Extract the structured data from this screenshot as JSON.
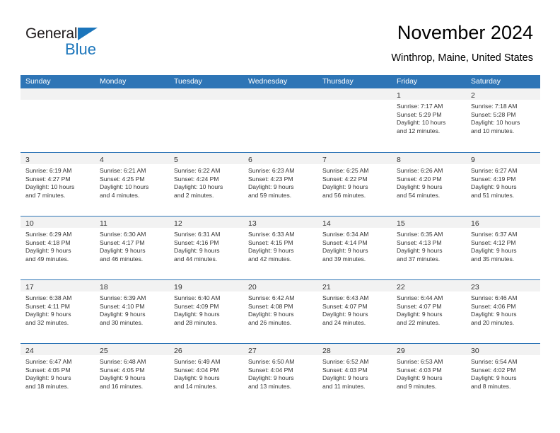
{
  "brand": {
    "name_dark": "General",
    "name_blue": "Blue",
    "accent_color": "#1b75bb"
  },
  "header": {
    "title": "November 2024",
    "subtitle": "Winthrop, Maine, United States"
  },
  "colors": {
    "header_blue": "#2e75b6",
    "daynum_band": "#f2f2f2",
    "text": "#333333"
  },
  "weekdays": [
    "Sunday",
    "Monday",
    "Tuesday",
    "Wednesday",
    "Thursday",
    "Friday",
    "Saturday"
  ],
  "weeks": [
    [
      {
        "day": ""
      },
      {
        "day": ""
      },
      {
        "day": ""
      },
      {
        "day": ""
      },
      {
        "day": ""
      },
      {
        "day": "1",
        "sunrise": "Sunrise: 7:17 AM",
        "sunset": "Sunset: 5:29 PM",
        "daylight1": "Daylight: 10 hours",
        "daylight2": "and 12 minutes."
      },
      {
        "day": "2",
        "sunrise": "Sunrise: 7:18 AM",
        "sunset": "Sunset: 5:28 PM",
        "daylight1": "Daylight: 10 hours",
        "daylight2": "and 10 minutes."
      }
    ],
    [
      {
        "day": "3",
        "sunrise": "Sunrise: 6:19 AM",
        "sunset": "Sunset: 4:27 PM",
        "daylight1": "Daylight: 10 hours",
        "daylight2": "and 7 minutes."
      },
      {
        "day": "4",
        "sunrise": "Sunrise: 6:21 AM",
        "sunset": "Sunset: 4:25 PM",
        "daylight1": "Daylight: 10 hours",
        "daylight2": "and 4 minutes."
      },
      {
        "day": "5",
        "sunrise": "Sunrise: 6:22 AM",
        "sunset": "Sunset: 4:24 PM",
        "daylight1": "Daylight: 10 hours",
        "daylight2": "and 2 minutes."
      },
      {
        "day": "6",
        "sunrise": "Sunrise: 6:23 AM",
        "sunset": "Sunset: 4:23 PM",
        "daylight1": "Daylight: 9 hours",
        "daylight2": "and 59 minutes."
      },
      {
        "day": "7",
        "sunrise": "Sunrise: 6:25 AM",
        "sunset": "Sunset: 4:22 PM",
        "daylight1": "Daylight: 9 hours",
        "daylight2": "and 56 minutes."
      },
      {
        "day": "8",
        "sunrise": "Sunrise: 6:26 AM",
        "sunset": "Sunset: 4:20 PM",
        "daylight1": "Daylight: 9 hours",
        "daylight2": "and 54 minutes."
      },
      {
        "day": "9",
        "sunrise": "Sunrise: 6:27 AM",
        "sunset": "Sunset: 4:19 PM",
        "daylight1": "Daylight: 9 hours",
        "daylight2": "and 51 minutes."
      }
    ],
    [
      {
        "day": "10",
        "sunrise": "Sunrise: 6:29 AM",
        "sunset": "Sunset: 4:18 PM",
        "daylight1": "Daylight: 9 hours",
        "daylight2": "and 49 minutes."
      },
      {
        "day": "11",
        "sunrise": "Sunrise: 6:30 AM",
        "sunset": "Sunset: 4:17 PM",
        "daylight1": "Daylight: 9 hours",
        "daylight2": "and 46 minutes."
      },
      {
        "day": "12",
        "sunrise": "Sunrise: 6:31 AM",
        "sunset": "Sunset: 4:16 PM",
        "daylight1": "Daylight: 9 hours",
        "daylight2": "and 44 minutes."
      },
      {
        "day": "13",
        "sunrise": "Sunrise: 6:33 AM",
        "sunset": "Sunset: 4:15 PM",
        "daylight1": "Daylight: 9 hours",
        "daylight2": "and 42 minutes."
      },
      {
        "day": "14",
        "sunrise": "Sunrise: 6:34 AM",
        "sunset": "Sunset: 4:14 PM",
        "daylight1": "Daylight: 9 hours",
        "daylight2": "and 39 minutes."
      },
      {
        "day": "15",
        "sunrise": "Sunrise: 6:35 AM",
        "sunset": "Sunset: 4:13 PM",
        "daylight1": "Daylight: 9 hours",
        "daylight2": "and 37 minutes."
      },
      {
        "day": "16",
        "sunrise": "Sunrise: 6:37 AM",
        "sunset": "Sunset: 4:12 PM",
        "daylight1": "Daylight: 9 hours",
        "daylight2": "and 35 minutes."
      }
    ],
    [
      {
        "day": "17",
        "sunrise": "Sunrise: 6:38 AM",
        "sunset": "Sunset: 4:11 PM",
        "daylight1": "Daylight: 9 hours",
        "daylight2": "and 32 minutes."
      },
      {
        "day": "18",
        "sunrise": "Sunrise: 6:39 AM",
        "sunset": "Sunset: 4:10 PM",
        "daylight1": "Daylight: 9 hours",
        "daylight2": "and 30 minutes."
      },
      {
        "day": "19",
        "sunrise": "Sunrise: 6:40 AM",
        "sunset": "Sunset: 4:09 PM",
        "daylight1": "Daylight: 9 hours",
        "daylight2": "and 28 minutes."
      },
      {
        "day": "20",
        "sunrise": "Sunrise: 6:42 AM",
        "sunset": "Sunset: 4:08 PM",
        "daylight1": "Daylight: 9 hours",
        "daylight2": "and 26 minutes."
      },
      {
        "day": "21",
        "sunrise": "Sunrise: 6:43 AM",
        "sunset": "Sunset: 4:07 PM",
        "daylight1": "Daylight: 9 hours",
        "daylight2": "and 24 minutes."
      },
      {
        "day": "22",
        "sunrise": "Sunrise: 6:44 AM",
        "sunset": "Sunset: 4:07 PM",
        "daylight1": "Daylight: 9 hours",
        "daylight2": "and 22 minutes."
      },
      {
        "day": "23",
        "sunrise": "Sunrise: 6:46 AM",
        "sunset": "Sunset: 4:06 PM",
        "daylight1": "Daylight: 9 hours",
        "daylight2": "and 20 minutes."
      }
    ],
    [
      {
        "day": "24",
        "sunrise": "Sunrise: 6:47 AM",
        "sunset": "Sunset: 4:05 PM",
        "daylight1": "Daylight: 9 hours",
        "daylight2": "and 18 minutes."
      },
      {
        "day": "25",
        "sunrise": "Sunrise: 6:48 AM",
        "sunset": "Sunset: 4:05 PM",
        "daylight1": "Daylight: 9 hours",
        "daylight2": "and 16 minutes."
      },
      {
        "day": "26",
        "sunrise": "Sunrise: 6:49 AM",
        "sunset": "Sunset: 4:04 PM",
        "daylight1": "Daylight: 9 hours",
        "daylight2": "and 14 minutes."
      },
      {
        "day": "27",
        "sunrise": "Sunrise: 6:50 AM",
        "sunset": "Sunset: 4:04 PM",
        "daylight1": "Daylight: 9 hours",
        "daylight2": "and 13 minutes."
      },
      {
        "day": "28",
        "sunrise": "Sunrise: 6:52 AM",
        "sunset": "Sunset: 4:03 PM",
        "daylight1": "Daylight: 9 hours",
        "daylight2": "and 11 minutes."
      },
      {
        "day": "29",
        "sunrise": "Sunrise: 6:53 AM",
        "sunset": "Sunset: 4:03 PM",
        "daylight1": "Daylight: 9 hours",
        "daylight2": "and 9 minutes."
      },
      {
        "day": "30",
        "sunrise": "Sunrise: 6:54 AM",
        "sunset": "Sunset: 4:02 PM",
        "daylight1": "Daylight: 9 hours",
        "daylight2": "and 8 minutes."
      }
    ]
  ]
}
